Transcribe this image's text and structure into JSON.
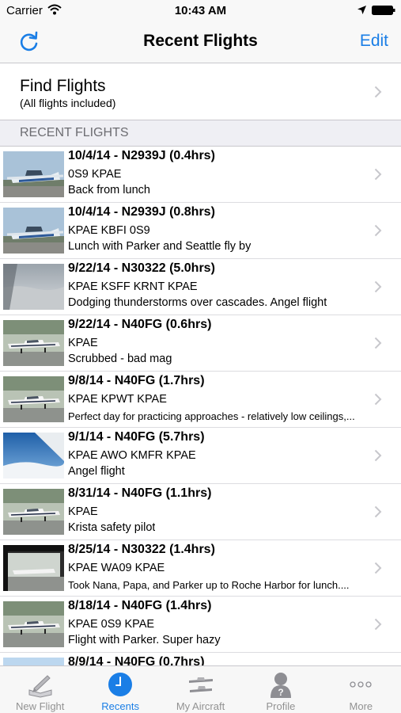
{
  "status_bar": {
    "carrier": "Carrier",
    "time": "10:43 AM"
  },
  "nav": {
    "title": "Recent Flights",
    "edit_label": "Edit",
    "accent_color": "#1a7ee6"
  },
  "find_flights": {
    "title": "Find Flights",
    "subtitle": "(All flights included)"
  },
  "section": {
    "title": "RECENT FLIGHTS"
  },
  "flights": [
    {
      "title": "10/4/14 - N2939J (0.4hrs)",
      "route": "0S9 KPAE",
      "comment": "Back from lunch",
      "thumb": "plane-blue"
    },
    {
      "title": "10/4/14 - N2939J (0.8hrs)",
      "route": "KPAE KBFI 0S9",
      "comment": "Lunch with Parker and Seattle fly by",
      "thumb": "plane-blue"
    },
    {
      "title": "9/22/14 - N30322 (5.0hrs)",
      "route": "KPAE KSFF KRNT KPAE",
      "comment": "Dodging thunderstorms over cascades. Angel flight",
      "thumb": "sky-gray"
    },
    {
      "title": "9/22/14 - N40FG (0.6hrs)",
      "route": "KPAE",
      "comment": "Scrubbed - bad mag",
      "thumb": "plane-white"
    },
    {
      "title": "9/8/14 - N40FG (1.7hrs)",
      "route": "KPAE KPWT KPAE",
      "comment": "Perfect day for practicing approaches - relatively low ceilings,...",
      "thumb": "plane-white",
      "small": true
    },
    {
      "title": "9/1/14 - N40FG (5.7hrs)",
      "route": "KPAE AWO KMFR KPAE",
      "comment": "Angel flight",
      "thumb": "wing-sky"
    },
    {
      "title": "8/31/14 - N40FG (1.1hrs)",
      "route": "KPAE",
      "comment": "Krista safety pilot",
      "thumb": "plane-white"
    },
    {
      "title": "8/25/14 - N30322 (1.4hrs)",
      "route": "KPAE WA09 KPAE",
      "comment": "Took Nana, Papa, and Parker up to Roche Harbor for lunch....",
      "thumb": "hangar-dark",
      "small": true
    },
    {
      "title": "8/18/14 - N40FG (1.4hrs)",
      "route": "KPAE 0S9 KPAE",
      "comment": "Flight with Parker. Super hazy",
      "thumb": "plane-white"
    },
    {
      "title": "8/9/14 - N40FG (0.7hrs)",
      "route": "",
      "comment": "",
      "thumb": "sky-blue"
    }
  ],
  "tabs": [
    {
      "label": "New Flight",
      "icon": "logbook-pen-icon",
      "active": false
    },
    {
      "label": "Recents",
      "icon": "clock-icon",
      "active": true
    },
    {
      "label": "My Aircraft",
      "icon": "aircraft-icon",
      "active": false
    },
    {
      "label": "Profile",
      "icon": "person-icon",
      "active": false
    },
    {
      "label": "More",
      "icon": "more-dots-icon",
      "active": false
    }
  ]
}
